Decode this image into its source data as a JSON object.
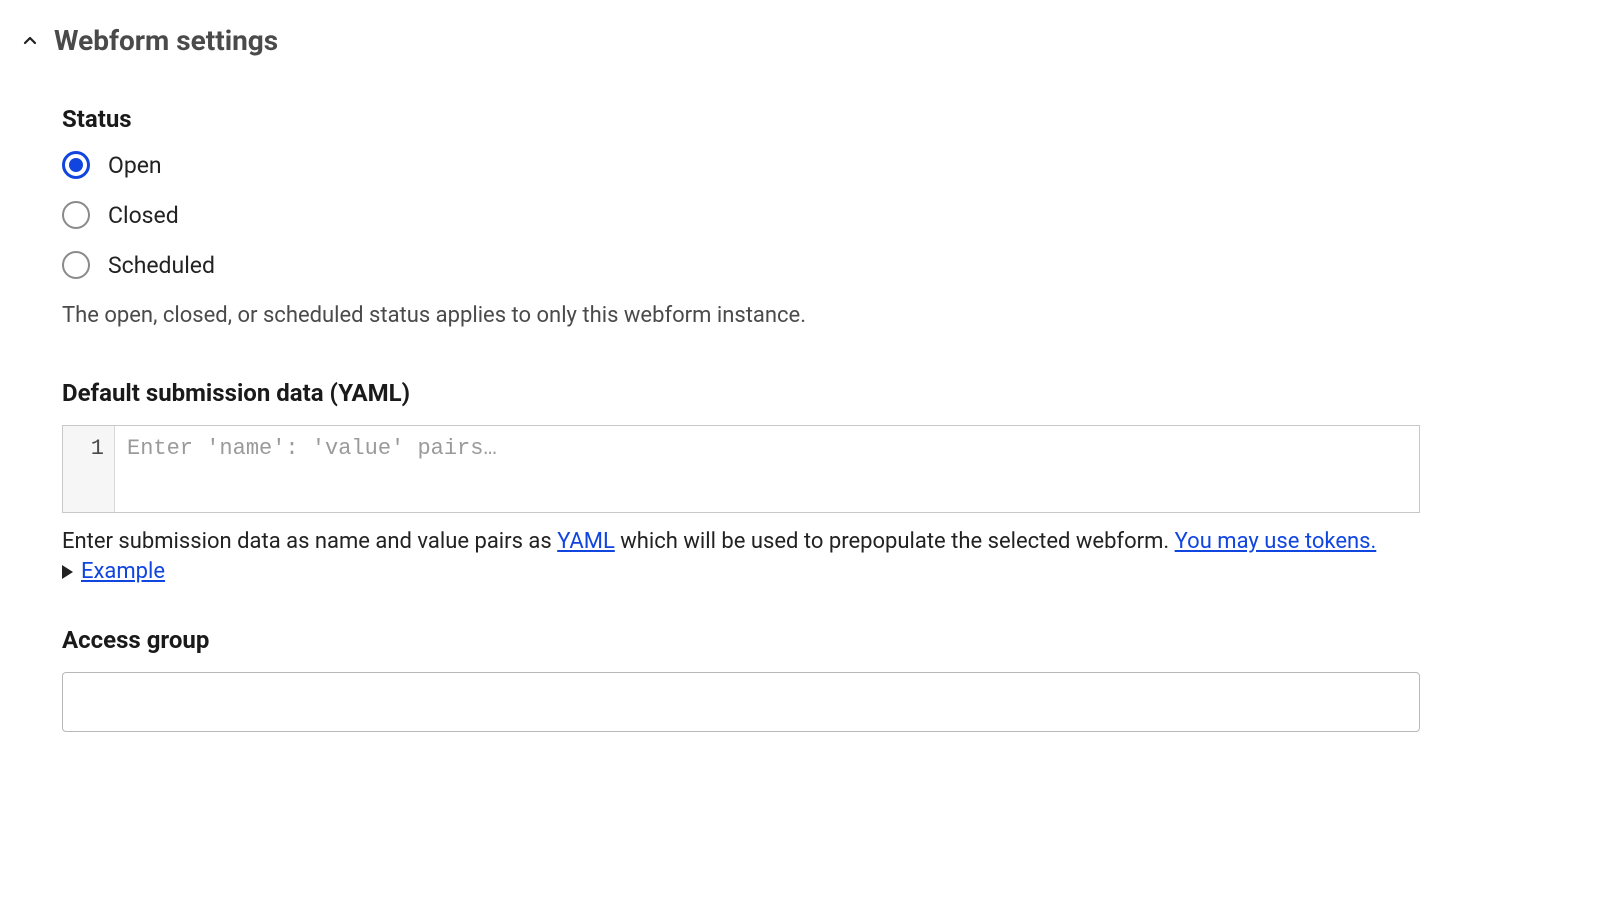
{
  "section": {
    "title": "Webform settings"
  },
  "status": {
    "label": "Status",
    "options": [
      {
        "label": "Open",
        "checked": true
      },
      {
        "label": "Closed",
        "checked": false
      },
      {
        "label": "Scheduled",
        "checked": false
      }
    ],
    "help": "The open, closed, or scheduled status applies to only this webform instance."
  },
  "defaultData": {
    "label": "Default submission data (YAML)",
    "lineNumber": "1",
    "placeholder": "Enter 'name': 'value' pairs…",
    "desc_pre": "Enter submission data as name and value pairs as ",
    "yaml_link": "YAML",
    "desc_mid": " which will be used to prepopulate the selected webform. ",
    "tokens_link": "You may use tokens.",
    "example": "Example"
  },
  "accessGroup": {
    "label": "Access group",
    "value": ""
  }
}
